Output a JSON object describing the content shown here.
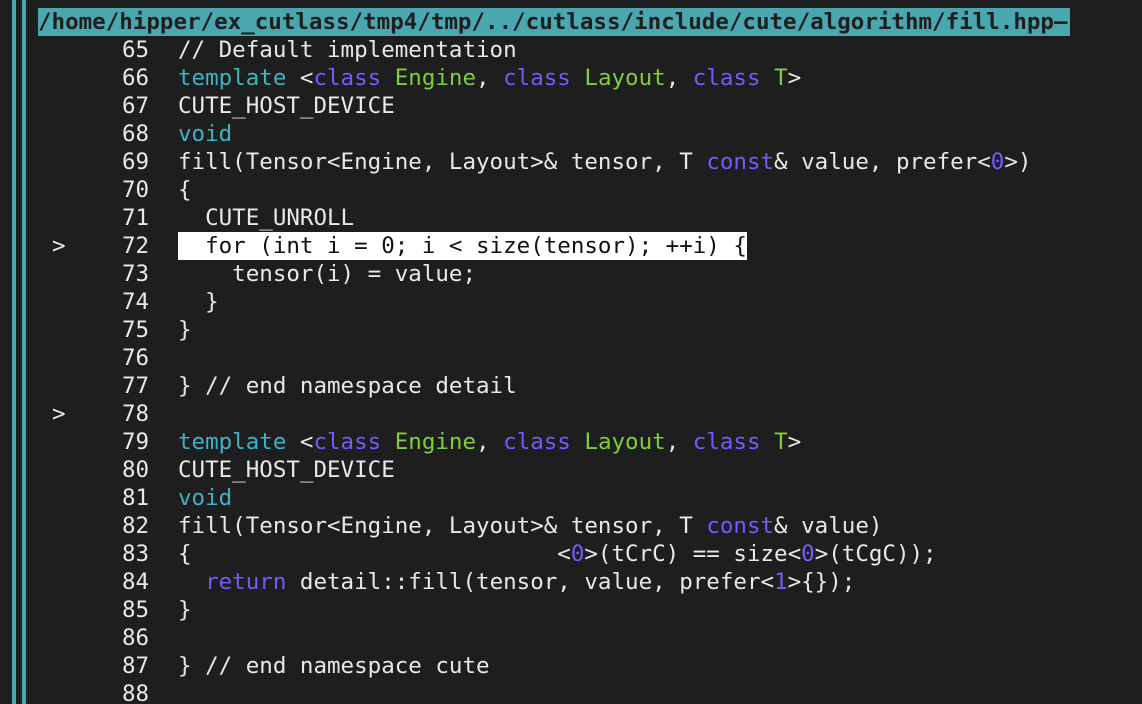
{
  "title_path": "/home/hipper/ex_cutlass/tmp4/tmp/../cutlass/include/cute/algorithm/fill.hpp",
  "title_trail": "—",
  "colors": {
    "accent": "#4aa7b0",
    "background": "#1e1e1e",
    "keyword": "#6f5cff",
    "keyword_template": "#3fb2c7",
    "type_param": "#7fcf3a",
    "number": "#6f5cff",
    "highlight_bg": "#ffffff"
  },
  "lines": [
    {
      "no": "65",
      "marker": "",
      "highlight": false,
      "tokens": [
        {
          "t": "// Default implementation",
          "c": "cm"
        }
      ]
    },
    {
      "no": "66",
      "marker": "",
      "highlight": false,
      "tokens": [
        {
          "t": "template",
          "c": "kwc"
        },
        {
          "t": " <",
          "c": "plain"
        },
        {
          "t": "class",
          "c": "kw"
        },
        {
          "t": " ",
          "c": "plain"
        },
        {
          "t": "Engine",
          "c": "type"
        },
        {
          "t": ", ",
          "c": "plain"
        },
        {
          "t": "class",
          "c": "kw"
        },
        {
          "t": " ",
          "c": "plain"
        },
        {
          "t": "Layout",
          "c": "type"
        },
        {
          "t": ", ",
          "c": "plain"
        },
        {
          "t": "class",
          "c": "kw"
        },
        {
          "t": " ",
          "c": "plain"
        },
        {
          "t": "T",
          "c": "type"
        },
        {
          "t": ">",
          "c": "plain"
        }
      ]
    },
    {
      "no": "67",
      "marker": "",
      "highlight": false,
      "tokens": [
        {
          "t": "CUTE_HOST_DEVICE",
          "c": "plain"
        }
      ]
    },
    {
      "no": "68",
      "marker": "",
      "highlight": false,
      "tokens": [
        {
          "t": "void",
          "c": "kwc"
        }
      ]
    },
    {
      "no": "69",
      "marker": "",
      "highlight": false,
      "tokens": [
        {
          "t": "fill(Tensor<Engine, Layout>& tensor, T ",
          "c": "plain"
        },
        {
          "t": "const",
          "c": "kw"
        },
        {
          "t": "& value, prefer<",
          "c": "plain"
        },
        {
          "t": "0",
          "c": "num"
        },
        {
          "t": ">)",
          "c": "plain"
        }
      ]
    },
    {
      "no": "70",
      "marker": "",
      "highlight": false,
      "tokens": [
        {
          "t": "{",
          "c": "plain"
        }
      ]
    },
    {
      "no": "71",
      "marker": "",
      "highlight": false,
      "tokens": [
        {
          "t": "  CUTE_UNROLL",
          "c": "plain"
        }
      ]
    },
    {
      "no": "72",
      "marker": ">",
      "highlight": true,
      "tokens": [
        {
          "t": "  for (int i = 0; i < size(tensor); ++i) {",
          "c": "plain"
        }
      ]
    },
    {
      "no": "73",
      "marker": "",
      "highlight": false,
      "tokens": [
        {
          "t": "    tensor(i) = value;",
          "c": "plain"
        }
      ]
    },
    {
      "no": "74",
      "marker": "",
      "highlight": false,
      "tokens": [
        {
          "t": "  }",
          "c": "plain"
        }
      ]
    },
    {
      "no": "75",
      "marker": "",
      "highlight": false,
      "tokens": [
        {
          "t": "}",
          "c": "plain"
        }
      ]
    },
    {
      "no": "76",
      "marker": "",
      "highlight": false,
      "tokens": []
    },
    {
      "no": "77",
      "marker": "",
      "highlight": false,
      "tokens": [
        {
          "t": "} // end namespace detail",
          "c": "cm"
        }
      ]
    },
    {
      "no": "78",
      "marker": ">",
      "highlight": false,
      "tokens": []
    },
    {
      "no": "79",
      "marker": "",
      "highlight": false,
      "tokens": [
        {
          "t": "template",
          "c": "kwc"
        },
        {
          "t": " <",
          "c": "plain"
        },
        {
          "t": "class",
          "c": "kw"
        },
        {
          "t": " ",
          "c": "plain"
        },
        {
          "t": "Engine",
          "c": "type"
        },
        {
          "t": ", ",
          "c": "plain"
        },
        {
          "t": "class",
          "c": "kw"
        },
        {
          "t": " ",
          "c": "plain"
        },
        {
          "t": "Layout",
          "c": "type"
        },
        {
          "t": ", ",
          "c": "plain"
        },
        {
          "t": "class",
          "c": "kw"
        },
        {
          "t": " ",
          "c": "plain"
        },
        {
          "t": "T",
          "c": "type"
        },
        {
          "t": ">",
          "c": "plain"
        }
      ]
    },
    {
      "no": "80",
      "marker": "",
      "highlight": false,
      "tokens": [
        {
          "t": "CUTE_HOST_DEVICE",
          "c": "plain"
        }
      ]
    },
    {
      "no": "81",
      "marker": "",
      "highlight": false,
      "tokens": [
        {
          "t": "void",
          "c": "kwc"
        }
      ]
    },
    {
      "no": "82",
      "marker": "",
      "highlight": false,
      "tokens": [
        {
          "t": "fill(Tensor<Engine, Layout>& tensor, T ",
          "c": "plain"
        },
        {
          "t": "const",
          "c": "kw"
        },
        {
          "t": "& value)",
          "c": "plain"
        }
      ]
    },
    {
      "no": "83",
      "marker": "",
      "highlight": false,
      "tokens": [
        {
          "t": "{                           <",
          "c": "plain"
        },
        {
          "t": "0",
          "c": "num"
        },
        {
          "t": ">(tCrC) == size<",
          "c": "plain"
        },
        {
          "t": "0",
          "c": "num"
        },
        {
          "t": ">(tCgC));",
          "c": "plain"
        }
      ]
    },
    {
      "no": "84",
      "marker": "",
      "highlight": false,
      "tokens": [
        {
          "t": "  ",
          "c": "plain"
        },
        {
          "t": "return",
          "c": "kw"
        },
        {
          "t": " detail::fill(tensor, value, prefer<",
          "c": "plain"
        },
        {
          "t": "1",
          "c": "num"
        },
        {
          "t": ">{});",
          "c": "plain"
        }
      ]
    },
    {
      "no": "85",
      "marker": "",
      "highlight": false,
      "tokens": [
        {
          "t": "}",
          "c": "plain"
        }
      ]
    },
    {
      "no": "86",
      "marker": "",
      "highlight": false,
      "tokens": []
    },
    {
      "no": "87",
      "marker": "",
      "highlight": false,
      "tokens": [
        {
          "t": "} // end namespace cute",
          "c": "cm"
        }
      ]
    },
    {
      "no": "88",
      "marker": "",
      "highlight": false,
      "tokens": []
    }
  ]
}
